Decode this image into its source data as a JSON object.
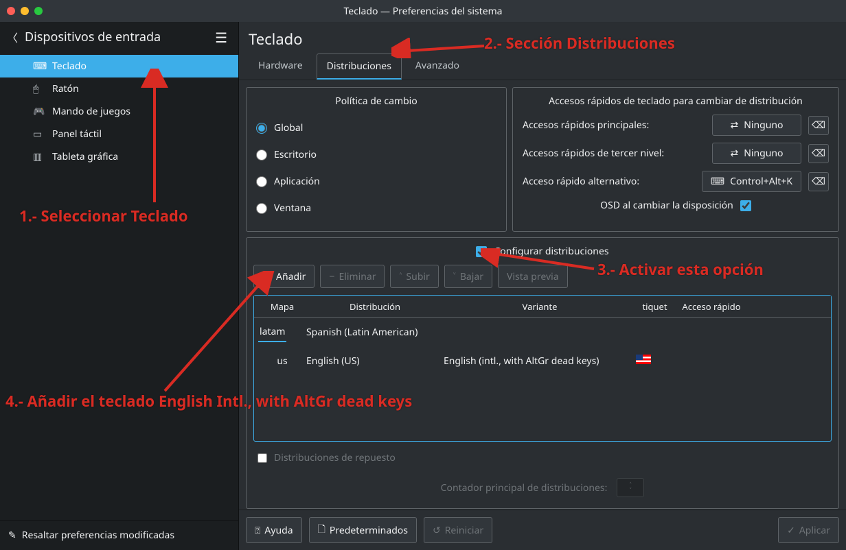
{
  "window": {
    "title": "Teclado — Preferencias del sistema"
  },
  "sidebar": {
    "back_label": "Dispositivos de entrada",
    "items": [
      {
        "icon": "⌨",
        "label": "Teclado"
      },
      {
        "icon": "🖱",
        "label": "Ratón"
      },
      {
        "icon": "🎮",
        "label": "Mando de juegos"
      },
      {
        "icon": "▭",
        "label": "Panel táctil"
      },
      {
        "icon": "▥",
        "label": "Tableta gráfica"
      }
    ],
    "footer": "Resaltar preferencias modificadas"
  },
  "main": {
    "title": "Teclado",
    "tabs": [
      {
        "label": "Hardware"
      },
      {
        "label": "Distribuciones"
      },
      {
        "label": "Avanzado"
      }
    ],
    "policy": {
      "title": "Política de cambio",
      "options": [
        "Global",
        "Escritorio",
        "Aplicación",
        "Ventana"
      ]
    },
    "shortcuts": {
      "title": "Accesos rápidos de teclado para cambiar de distribución",
      "rows": [
        {
          "label": "Accesos rápidos principales:",
          "value": "Ninguno"
        },
        {
          "label": "Accesos rápidos de tercer nivel:",
          "value": "Ninguno"
        },
        {
          "label": "Acceso rápido alternativo:",
          "value": "Control+Alt+K"
        }
      ],
      "osd": "OSD al cambiar la disposición"
    },
    "config": {
      "check": "Configurar distribuciones",
      "buttons": {
        "add": "Añadir",
        "remove": "Eliminar",
        "up": "Subir",
        "down": "Bajar",
        "preview": "Vista previa"
      },
      "headers": [
        "Mapa",
        "Distribución",
        "Variante",
        "tiquet",
        "Acceso rápido",
        ""
      ],
      "rows": [
        {
          "mapa": "latam",
          "dist": "Spanish (Latin American)",
          "variant": "",
          "flag": ""
        },
        {
          "mapa": "us",
          "dist": "English (US)",
          "variant": "English (intl., with AltGr dead keys)",
          "flag": "us"
        }
      ],
      "spare": "Distribuciones de repuesto",
      "counter": "Contador principal de distribuciones:"
    },
    "footer": {
      "help": "Ayuda",
      "defaults": "Predeterminados",
      "reset": "Reiniciar",
      "apply": "Aplicar"
    }
  },
  "annotations": {
    "a1": "1.- Seleccionar Teclado",
    "a2": "2.- Sección Distribuciones",
    "a3": "3.- Activar esta opción",
    "a4": "4.- Añadir el teclado English Intl., with AltGr dead keys"
  }
}
